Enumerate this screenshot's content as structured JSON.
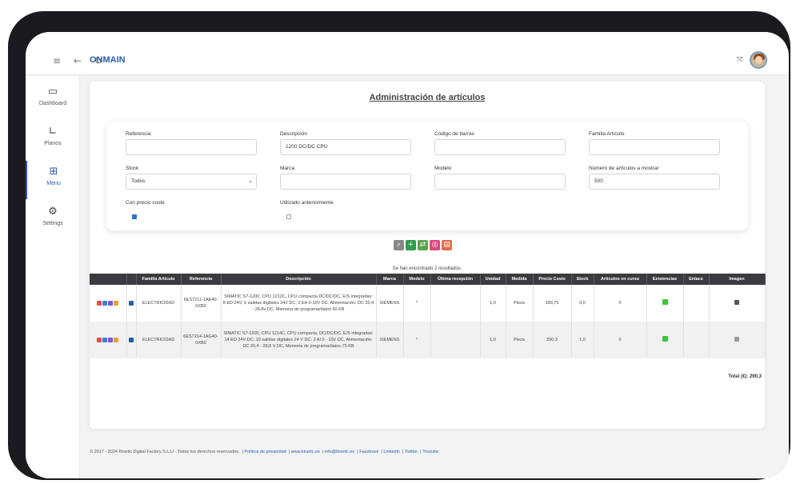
{
  "topbar": {
    "brand": "ONMAIN",
    "nav_icons": "≡ ← ↻",
    "expand_icon": "⤧"
  },
  "sidebar": {
    "items": [
      {
        "label": "Dashboard",
        "icon": "monitor-icon",
        "glyph": "▭"
      },
      {
        "label": "Planos",
        "icon": "floorplan-icon",
        "glyph": "∟"
      },
      {
        "label": "Menu",
        "icon": "sitemap-icon",
        "glyph": "⊞",
        "active": true
      },
      {
        "label": "Settings",
        "icon": "gear-icon",
        "glyph": "⚙"
      }
    ]
  },
  "page": {
    "title": "Administración de artículos"
  },
  "filters": {
    "referencia": {
      "label": "Referencia",
      "value": ""
    },
    "descripcion": {
      "label": "Descripción",
      "value": "1200 DC/DC CPU"
    },
    "codigo_barras": {
      "label": "Código de barras",
      "value": ""
    },
    "familia": {
      "label": "Familia Artículo",
      "value": ""
    },
    "stock": {
      "label": "Stock",
      "value": "Todos"
    },
    "marca": {
      "label": "Marca",
      "value": ""
    },
    "modelo": {
      "label": "Modelo",
      "value": ""
    },
    "num_articulos": {
      "label": "Número de artículos a mostrar",
      "value": "500"
    },
    "con_precio_coste": {
      "label": "Con precio coste",
      "checked": true
    },
    "utilizado": {
      "label": "Utilizado anteriormente",
      "checked": false
    }
  },
  "actions": [
    {
      "name": "search-button",
      "glyph": "⌕",
      "color": "#888888"
    },
    {
      "name": "add-button",
      "glyph": "+",
      "color": "#2e9e4a"
    },
    {
      "name": "export-button",
      "glyph": "⇄",
      "color": "#5aa54a"
    },
    {
      "name": "pdf-button",
      "glyph": "◎",
      "color": "#e0457b"
    },
    {
      "name": "print-button",
      "glyph": "▤",
      "color": "#e66a4a"
    }
  ],
  "results": {
    "text": "Se han encontrado 2 resultados."
  },
  "table": {
    "headers": [
      "",
      "",
      "Familia Artículo",
      "Referencia",
      "Descripción",
      "Marca",
      "Modelo",
      "Última recepción",
      "Unidad",
      "Medida",
      "Precio Coste",
      "Stock",
      "Artículos en curso",
      "Existencias",
      "Enlace",
      "Imagen"
    ],
    "rows": [
      {
        "familia": "ELECTRICIDAD",
        "referencia": "6ES7212-1AE40-0XB0",
        "descripcion": "SIMATIC S7-1200, CPU 1212C, CPU compacta DC/DC/DC, E/S integradas: 8 ED 24V; 6 salidas digitales 24V DC; 2 EA 0-10V DC, Alimentación: DC 20,4 - 28,8v DC, Memoria de programa/datos 50 KB",
        "marca": "SIEMENS",
        "modelo": "*",
        "ultima": "",
        "unidad": "1,0",
        "medida": "Pieza",
        "precio": "189,75",
        "stock": "0,0",
        "en_curso": "0",
        "enlace": ""
      },
      {
        "familia": "ELECTRICIDAD",
        "referencia": "6ES7214-1AG40-0XB0",
        "descripcion": "SIMATIC S7-1200, CPU 1214C, CPU compacta, DC/DC/DC, E/S integradas: 14 ED 24V DC; 10 salidas digitales 24 V DC; 2 AI 0 - 10V DC, Alimentación: DC 20,4 - 28,8 V DC, Memoria de programa/datos 75 KB",
        "marca": "SIEMENS",
        "modelo": "*",
        "ultima": "",
        "unidad": "1,0",
        "medida": "Pieza",
        "precio": "290,3",
        "stock": "1,0",
        "en_curso": "0",
        "enlace": ""
      }
    ],
    "total": "Total (€): 290,3"
  },
  "row_icon_colors": [
    "#e84a4a",
    "#3a7fd6",
    "#7a5ad6",
    "#e8a03a",
    "#2a5da8"
  ],
  "footer": {
    "copyright": "© 2017 - 2024 Kinetic Digital Factory S.L.U  -  Todos los derechos reservados.",
    "links": [
      "Política de privacidad",
      "www.kinetic.es",
      "info@kinetic.es",
      "Facebook",
      "Linkedin",
      "Twitter",
      "Youtube"
    ]
  }
}
